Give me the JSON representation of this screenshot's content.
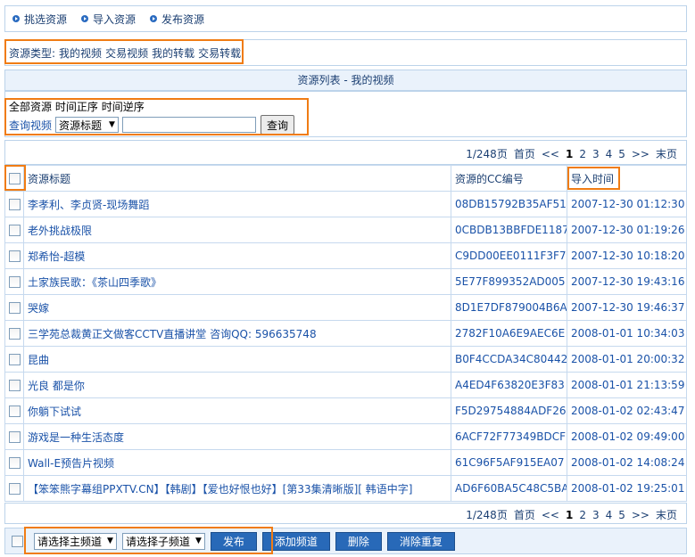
{
  "nav": {
    "items": [
      {
        "label": "挑选资源"
      },
      {
        "label": "导入资源"
      },
      {
        "label": "发布资源"
      }
    ]
  },
  "types": {
    "prefix": "资源类型:",
    "items": [
      "我的视频",
      "交易视频",
      "我的转载",
      "交易转载"
    ]
  },
  "list_header": "资源列表 - 我的视频",
  "filter": {
    "row1": [
      "全部资源",
      "时间正序",
      "时间逆序"
    ],
    "query_label": "查询视频",
    "select_value": "资源标题",
    "input_value": "",
    "search_button": "查询"
  },
  "pagination": {
    "info": "1/248页",
    "first": "首页",
    "prev": "<<",
    "pages": [
      "1",
      "2",
      "3",
      "4",
      "5"
    ],
    "current": "1",
    "next": ">>",
    "last": "末页"
  },
  "table": {
    "headers": {
      "title": "资源标题",
      "code": "资源的CC编号",
      "time": "导入时间"
    },
    "rows": [
      {
        "title": "李孝利、李贞贤-现场舞蹈",
        "code": "08DB15792B35AF51",
        "time": "2007-12-30 01:12:30"
      },
      {
        "title": "老外挑战极限",
        "code": "0CBDB13BBFDE1187",
        "time": "2007-12-30 01:19:26"
      },
      {
        "title": "郑希怡-超模",
        "code": "C9DD00EE0111F3F7",
        "time": "2007-12-30 10:18:20"
      },
      {
        "title": "土家族民歌：《茶山四季歌》",
        "code": "5E77F899352AD005",
        "time": "2007-12-30 19:43:16"
      },
      {
        "title": "哭嫁",
        "code": "8D1E7DF879004B6A",
        "time": "2007-12-30 19:46:37"
      },
      {
        "title": "三学苑总裁黄正文做客CCTV直播讲堂 咨询QQ: 596635748",
        "code": "2782F10A6E9AEC6E",
        "time": "2008-01-01 10:34:03"
      },
      {
        "title": "昆曲",
        "code": "B0F4CCDA34C80442",
        "time": "2008-01-01 20:00:32"
      },
      {
        "title": "光良 都是你",
        "code": "A4ED4F63820E3F83",
        "time": "2008-01-01 21:13:59"
      },
      {
        "title": "你躺下试试",
        "code": "F5D29754884ADF26",
        "time": "2008-01-02 02:43:47"
      },
      {
        "title": "游戏是一种生活态度",
        "code": "6ACF72F77349BDCF",
        "time": "2008-01-02 09:49:00"
      },
      {
        "title": "Wall-E预告片视频",
        "code": "61C96F5AF915EA07",
        "time": "2008-01-02 14:08:24"
      },
      {
        "title": "【笨笨熊字幕组PPXTV.CN】【韩剧】【爱也好恨也好】[第33集清晰版][ 韩语中字]",
        "code": "AD6F60BA5C48C5BA",
        "time": "2008-01-02 19:25:01"
      }
    ]
  },
  "bottom": {
    "main_channel": "请选择主频道",
    "sub_channel": "请选择子频道",
    "publish": "发布",
    "add_channel": "添加频道",
    "delete": "删除",
    "dedupe": "消除重复"
  },
  "colors": {
    "highlight": "#f07c14",
    "button": "#2869b8",
    "link": "#1a52a8",
    "border": "#bcd3ea"
  },
  "icons": {
    "nav_bullet": "arrow-bullet-icon",
    "dropdown": "chevron-down-icon"
  }
}
